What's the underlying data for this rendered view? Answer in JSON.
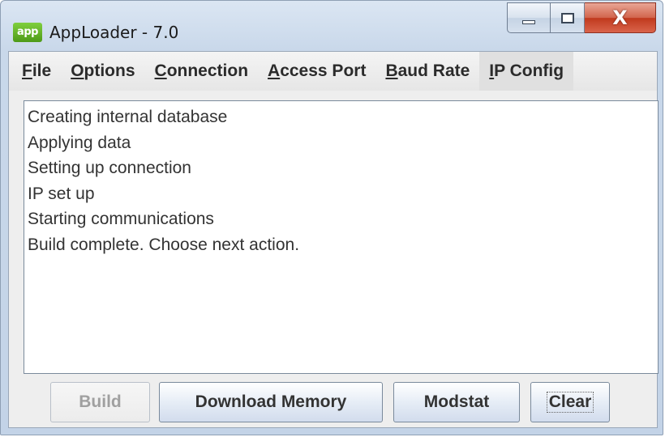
{
  "window": {
    "icon_text": "app",
    "title": "AppLoader - 7.0",
    "controls": {
      "close": "X"
    }
  },
  "menu": [
    {
      "mnemonic": "F",
      "rest": "ile"
    },
    {
      "mnemonic": "O",
      "rest": "ptions"
    },
    {
      "mnemonic": "C",
      "rest": "onnection"
    },
    {
      "mnemonic": "A",
      "rest": "ccess Port"
    },
    {
      "mnemonic": "B",
      "rest": "aud Rate"
    },
    {
      "mnemonic": "I",
      "rest": "P Config"
    }
  ],
  "output_lines": [
    "Creating internal database",
    "Applying data",
    "Setting up connection",
    "IP set up",
    "Starting communications",
    "Build complete.  Choose next action."
  ],
  "buttons": {
    "build": "Build",
    "download_memory": "Download Memory",
    "modstat": "Modstat",
    "clear": "Clear"
  }
}
